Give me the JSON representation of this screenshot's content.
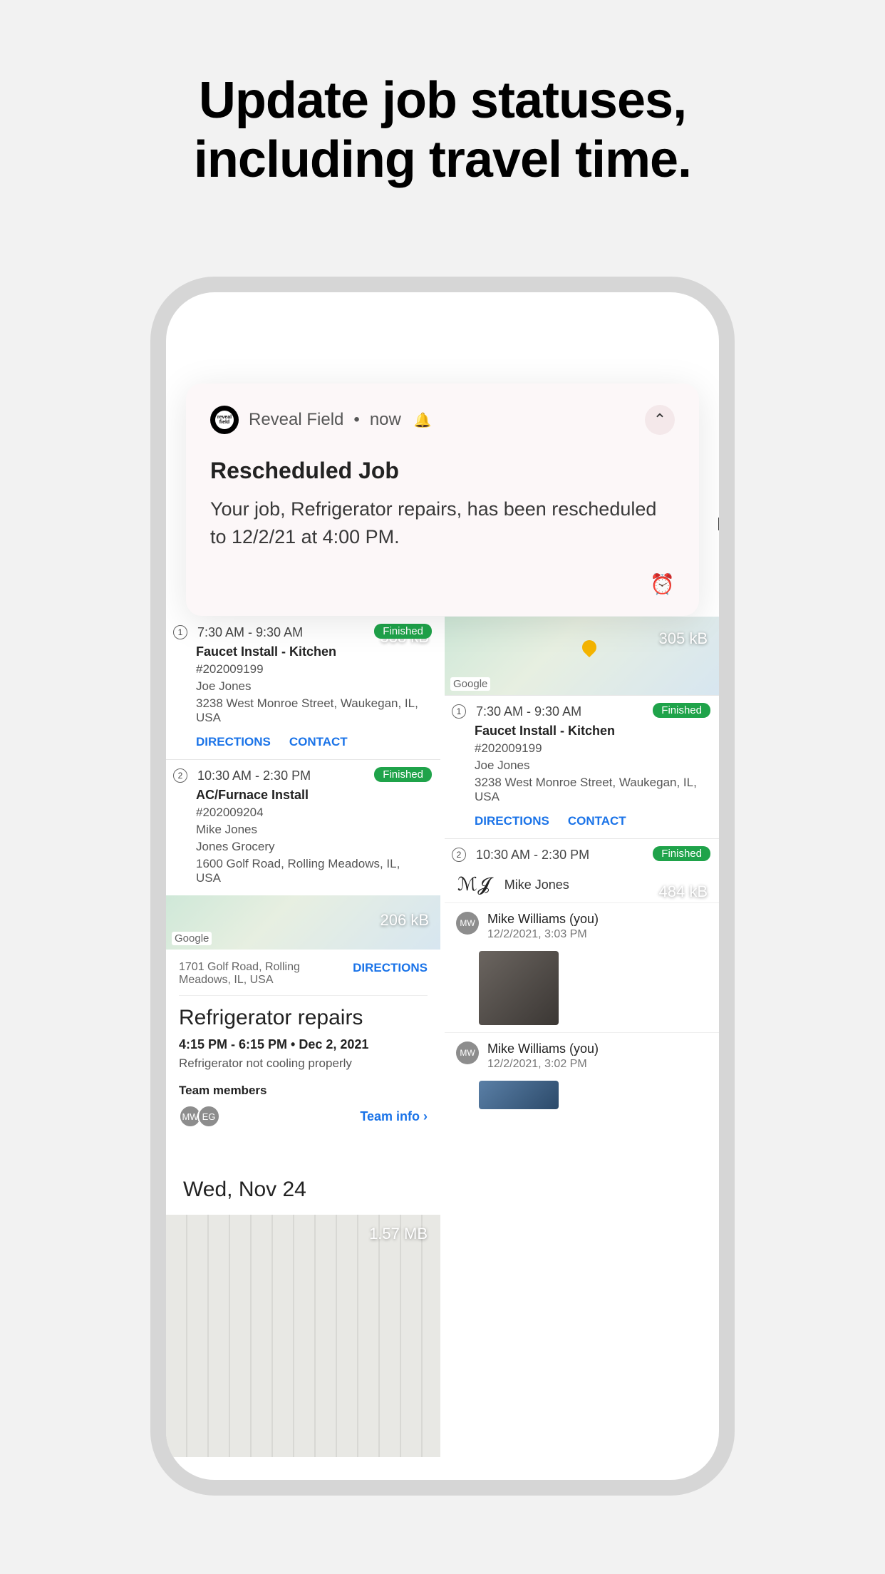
{
  "hero": {
    "line1": "Update job statuses,",
    "line2": "including travel time."
  },
  "notification": {
    "app_name": "Reveal Field",
    "when": "now",
    "title": "Rescheduled Job",
    "body": "Your job, Refrigerator repairs, has been rescheduled to 12/2/21 at 4:00 PM."
  },
  "inbox_peek": "I",
  "left_col": {
    "job1": {
      "num": "1",
      "time": "7:30 AM - 9:30 AM",
      "status": "Finished",
      "size": "338 kB",
      "title": "Faucet Install - Kitchen",
      "ref": "#202009199",
      "person": "Joe Jones",
      "addr": "3238 West Monroe Street, Waukegan, IL, USA",
      "link1": "DIRECTIONS",
      "link2": "CONTACT"
    },
    "job2": {
      "num": "2",
      "time": "10:30 AM - 2:30 PM",
      "status": "Finished",
      "title": "AC/Furnace Install",
      "ref": "#202009204",
      "person": "Mike Jones",
      "company": "Jones Grocery",
      "addr": "1600 Golf Road, Rolling Meadows, IL, USA"
    },
    "map_size": "206 kB",
    "detail": {
      "addr": "1701 Golf Road, Rolling Meadows, IL, USA",
      "dir": "DIRECTIONS",
      "heading": "Refrigerator repairs",
      "datetime": "4:15 PM - 6:15 PM  •  Dec 2, 2021",
      "desc": "Refrigerator not cooling properly",
      "team_label": "Team members",
      "av1": "MW",
      "av2": "EG",
      "team_info": "Team info  ›"
    },
    "date_header": "Wed, Nov 24",
    "doc_size": "1.57 MB"
  },
  "right_col": {
    "map_size": "305 kB",
    "job1": {
      "num": "1",
      "time": "7:30 AM - 9:30 AM",
      "status": "Finished",
      "title": "Faucet Install - Kitchen",
      "ref": "#202009199",
      "person": "Joe Jones",
      "addr": "3238 West Monroe Street, Waukegan, IL, USA",
      "link1": "DIRECTIONS",
      "link2": "CONTACT"
    },
    "job2": {
      "num": "2",
      "time": "10:30 AM - 2:30 PM",
      "status": "Finished"
    },
    "sig_name": "Mike Jones",
    "sig_size": "484 kB",
    "feed1": {
      "initials": "MW",
      "name": "Mike Williams (you)",
      "ts": "12/2/2021, 3:03 PM"
    },
    "feed2": {
      "initials": "MW",
      "name": "Mike Williams (you)",
      "ts": "12/2/2021, 3:02 PM"
    }
  }
}
